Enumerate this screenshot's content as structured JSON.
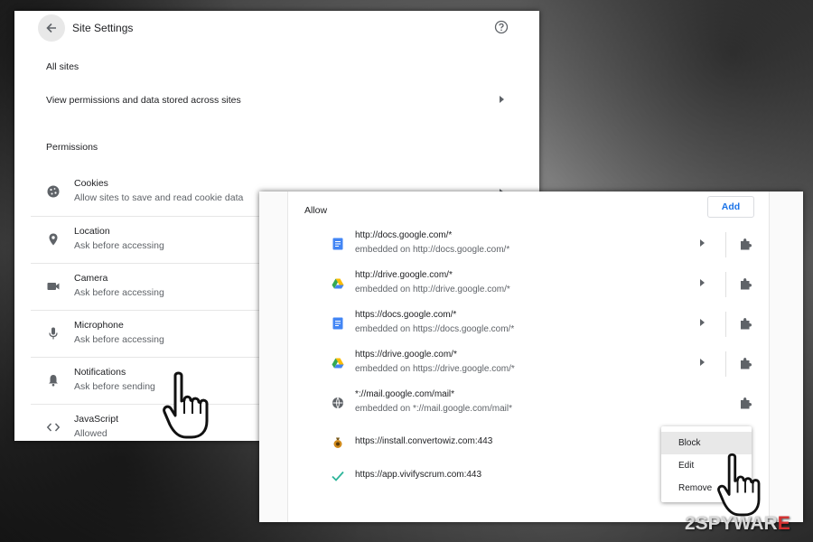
{
  "site_settings": {
    "title": "Site Settings",
    "all_sites_heading": "All sites",
    "view_permissions": "View permissions and data stored across sites",
    "permissions_heading": "Permissions",
    "permissions": [
      {
        "label": "Cookies",
        "sub": "Allow sites to save and read cookie data",
        "icon": "cookie-icon"
      },
      {
        "label": "Location",
        "sub": "Ask before accessing",
        "icon": "location-pin-icon"
      },
      {
        "label": "Camera",
        "sub": "Ask before accessing",
        "icon": "camera-icon"
      },
      {
        "label": "Microphone",
        "sub": "Ask before accessing",
        "icon": "microphone-icon"
      },
      {
        "label": "Notifications",
        "sub": "Ask before sending",
        "icon": "bell-icon"
      },
      {
        "label": "JavaScript",
        "sub": "Allowed",
        "icon": "code-icon"
      }
    ]
  },
  "allow_list": {
    "title": "Allow",
    "add_label": "Add",
    "sites": [
      {
        "url": "http://docs.google.com/*",
        "embedded": "embedded on http://docs.google.com/*",
        "icon": "google-docs-icon"
      },
      {
        "url": "http://drive.google.com/*",
        "embedded": "embedded on http://drive.google.com/*",
        "icon": "google-drive-icon"
      },
      {
        "url": "https://docs.google.com/*",
        "embedded": "embedded on https://docs.google.com/*",
        "icon": "google-docs-icon"
      },
      {
        "url": "https://drive.google.com/*",
        "embedded": "embedded on https://drive.google.com/*",
        "icon": "google-drive-icon"
      },
      {
        "url": "*://mail.google.com/mail*",
        "embedded": "embedded on *://mail.google.com/mail*",
        "icon": "globe-icon"
      },
      {
        "url": "https://install.convertowiz.com:443",
        "embedded": "",
        "icon": "convertowiz-icon"
      },
      {
        "url": "https://app.vivifyscrum.com:443",
        "embedded": "",
        "icon": "vivifyscrum-icon"
      }
    ]
  },
  "context_menu": {
    "items": [
      "Block",
      "Edit",
      "Remove"
    ],
    "highlighted": "Block"
  },
  "watermark": {
    "prefix": "2SPYWAR",
    "accent": "E"
  },
  "colors": {
    "accent": "#1a73e8",
    "watermark_accent": "#d43030"
  }
}
